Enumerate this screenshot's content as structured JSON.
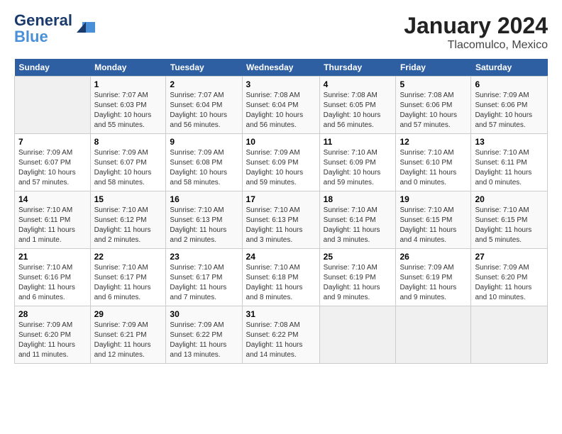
{
  "header": {
    "logo_line1": "General",
    "logo_line2": "Blue",
    "title": "January 2024",
    "subtitle": "Tlacomulco, Mexico"
  },
  "days_of_week": [
    "Sunday",
    "Monday",
    "Tuesday",
    "Wednesday",
    "Thursday",
    "Friday",
    "Saturday"
  ],
  "weeks": [
    [
      {
        "day": "",
        "info": ""
      },
      {
        "day": "1",
        "info": "Sunrise: 7:07 AM\nSunset: 6:03 PM\nDaylight: 10 hours\nand 55 minutes."
      },
      {
        "day": "2",
        "info": "Sunrise: 7:07 AM\nSunset: 6:04 PM\nDaylight: 10 hours\nand 56 minutes."
      },
      {
        "day": "3",
        "info": "Sunrise: 7:08 AM\nSunset: 6:04 PM\nDaylight: 10 hours\nand 56 minutes."
      },
      {
        "day": "4",
        "info": "Sunrise: 7:08 AM\nSunset: 6:05 PM\nDaylight: 10 hours\nand 56 minutes."
      },
      {
        "day": "5",
        "info": "Sunrise: 7:08 AM\nSunset: 6:06 PM\nDaylight: 10 hours\nand 57 minutes."
      },
      {
        "day": "6",
        "info": "Sunrise: 7:09 AM\nSunset: 6:06 PM\nDaylight: 10 hours\nand 57 minutes."
      }
    ],
    [
      {
        "day": "7",
        "info": "Sunrise: 7:09 AM\nSunset: 6:07 PM\nDaylight: 10 hours\nand 57 minutes."
      },
      {
        "day": "8",
        "info": "Sunrise: 7:09 AM\nSunset: 6:07 PM\nDaylight: 10 hours\nand 58 minutes."
      },
      {
        "day": "9",
        "info": "Sunrise: 7:09 AM\nSunset: 6:08 PM\nDaylight: 10 hours\nand 58 minutes."
      },
      {
        "day": "10",
        "info": "Sunrise: 7:09 AM\nSunset: 6:09 PM\nDaylight: 10 hours\nand 59 minutes."
      },
      {
        "day": "11",
        "info": "Sunrise: 7:10 AM\nSunset: 6:09 PM\nDaylight: 10 hours\nand 59 minutes."
      },
      {
        "day": "12",
        "info": "Sunrise: 7:10 AM\nSunset: 6:10 PM\nDaylight: 11 hours\nand 0 minutes."
      },
      {
        "day": "13",
        "info": "Sunrise: 7:10 AM\nSunset: 6:11 PM\nDaylight: 11 hours\nand 0 minutes."
      }
    ],
    [
      {
        "day": "14",
        "info": "Sunrise: 7:10 AM\nSunset: 6:11 PM\nDaylight: 11 hours\nand 1 minute."
      },
      {
        "day": "15",
        "info": "Sunrise: 7:10 AM\nSunset: 6:12 PM\nDaylight: 11 hours\nand 2 minutes."
      },
      {
        "day": "16",
        "info": "Sunrise: 7:10 AM\nSunset: 6:13 PM\nDaylight: 11 hours\nand 2 minutes."
      },
      {
        "day": "17",
        "info": "Sunrise: 7:10 AM\nSunset: 6:13 PM\nDaylight: 11 hours\nand 3 minutes."
      },
      {
        "day": "18",
        "info": "Sunrise: 7:10 AM\nSunset: 6:14 PM\nDaylight: 11 hours\nand 3 minutes."
      },
      {
        "day": "19",
        "info": "Sunrise: 7:10 AM\nSunset: 6:15 PM\nDaylight: 11 hours\nand 4 minutes."
      },
      {
        "day": "20",
        "info": "Sunrise: 7:10 AM\nSunset: 6:15 PM\nDaylight: 11 hours\nand 5 minutes."
      }
    ],
    [
      {
        "day": "21",
        "info": "Sunrise: 7:10 AM\nSunset: 6:16 PM\nDaylight: 11 hours\nand 6 minutes."
      },
      {
        "day": "22",
        "info": "Sunrise: 7:10 AM\nSunset: 6:17 PM\nDaylight: 11 hours\nand 6 minutes."
      },
      {
        "day": "23",
        "info": "Sunrise: 7:10 AM\nSunset: 6:17 PM\nDaylight: 11 hours\nand 7 minutes."
      },
      {
        "day": "24",
        "info": "Sunrise: 7:10 AM\nSunset: 6:18 PM\nDaylight: 11 hours\nand 8 minutes."
      },
      {
        "day": "25",
        "info": "Sunrise: 7:10 AM\nSunset: 6:19 PM\nDaylight: 11 hours\nand 9 minutes."
      },
      {
        "day": "26",
        "info": "Sunrise: 7:09 AM\nSunset: 6:19 PM\nDaylight: 11 hours\nand 9 minutes."
      },
      {
        "day": "27",
        "info": "Sunrise: 7:09 AM\nSunset: 6:20 PM\nDaylight: 11 hours\nand 10 minutes."
      }
    ],
    [
      {
        "day": "28",
        "info": "Sunrise: 7:09 AM\nSunset: 6:20 PM\nDaylight: 11 hours\nand 11 minutes."
      },
      {
        "day": "29",
        "info": "Sunrise: 7:09 AM\nSunset: 6:21 PM\nDaylight: 11 hours\nand 12 minutes."
      },
      {
        "day": "30",
        "info": "Sunrise: 7:09 AM\nSunset: 6:22 PM\nDaylight: 11 hours\nand 13 minutes."
      },
      {
        "day": "31",
        "info": "Sunrise: 7:08 AM\nSunset: 6:22 PM\nDaylight: 11 hours\nand 14 minutes."
      },
      {
        "day": "",
        "info": ""
      },
      {
        "day": "",
        "info": ""
      },
      {
        "day": "",
        "info": ""
      }
    ]
  ]
}
